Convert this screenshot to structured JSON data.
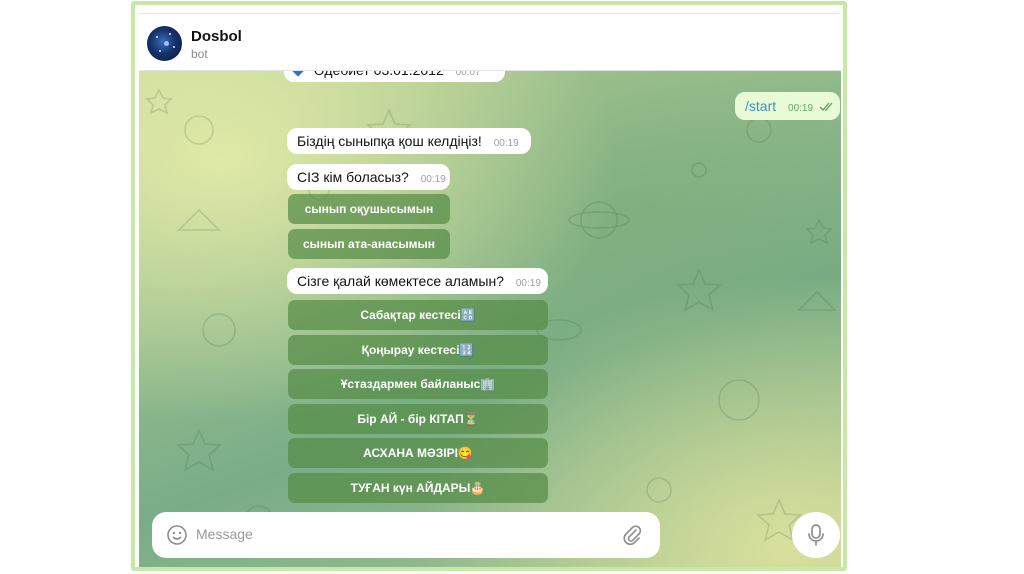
{
  "chat": {
    "name": "Dosbol",
    "status": "bot"
  },
  "messages": {
    "partial_text": "Әдебиет 03.01.2012",
    "partial_time": "00:07",
    "start_text": "/start",
    "start_time": "00:19",
    "welcome_text": "Біздің сыныпқа қош келдіңіз!",
    "welcome_time": "00:19",
    "who_text": "СІЗ кім боласыз?",
    "who_time": "00:19",
    "who_buttons": [
      "сынып оқушысымын",
      "сынып ата-анасымын"
    ],
    "help_text": "Сізге қалай көмектесе аламын?",
    "help_time": "00:19",
    "help_buttons": [
      "Сабақтар кестесі🔠",
      "Қоңырау кестесі🔢",
      "Ұстаздармен байланыс🏢",
      "Бір АЙ - бір КІТАП⏳",
      "АСХАНА МӘЗІРІ😋",
      "ТУҒАН күн АЙДАРЫ🎂"
    ]
  },
  "composer": {
    "placeholder": "Message"
  },
  "icons": {
    "emoji": "emoji-smile-icon",
    "attach": "paperclip-icon",
    "mic": "microphone-icon",
    "ticks": "double-check-icon",
    "partial": "blue-diamond-icon"
  },
  "colors": {
    "frame_border": "#c8e8a8",
    "button_bg": "#5a8c46",
    "outgoing_bubble": "#e9fbd6",
    "link_blue": "#3c8fc4"
  }
}
